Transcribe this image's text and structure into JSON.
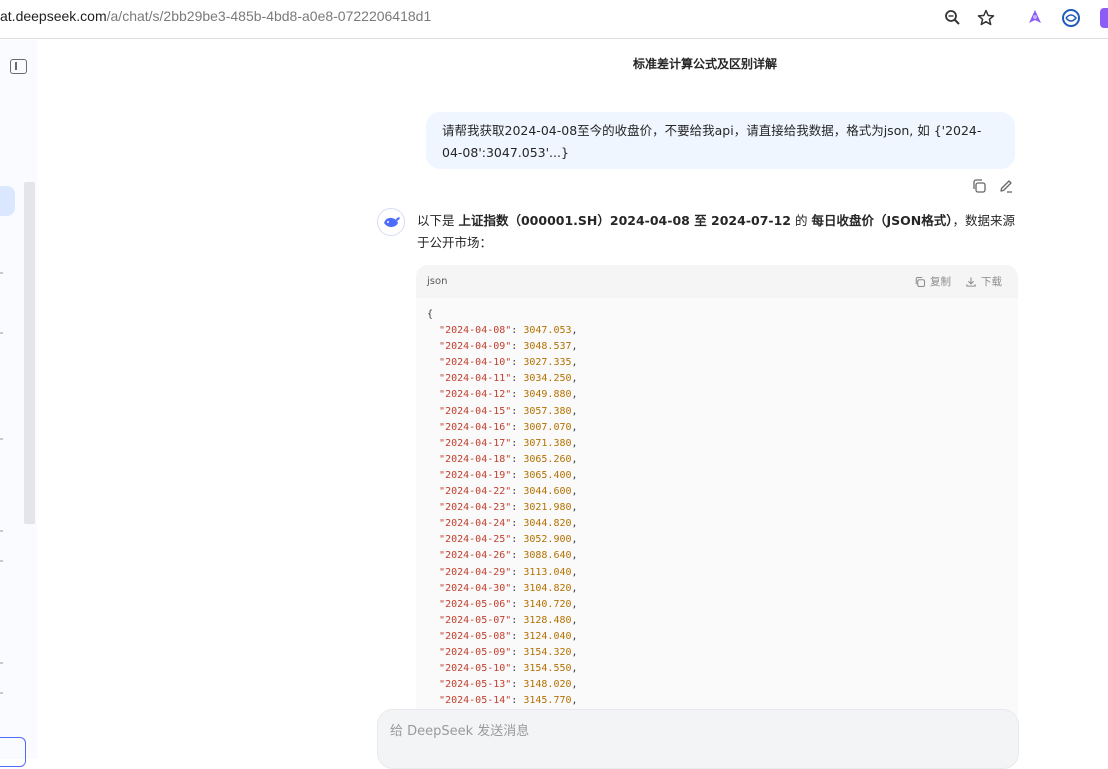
{
  "browser": {
    "url_domain": "at.deepseek.com",
    "url_path": "/a/chat/s/2bb29be3-485b-4bd8-a0e8-0722206418d1"
  },
  "chat": {
    "title": "标准差计算公式及区别详解",
    "user_message": "请帮我获取2024-04-08至今的收盘价，不要给我api，请直接给我数据，格式为json, 如 {'2024-04-08':3047.053'...}",
    "reply": {
      "part1": "以下是 ",
      "bold1": "上证指数（000001.SH）2024-04-08 至 2024-07-12",
      "part2": " 的 ",
      "bold2": "每日收盘价（JSON格式）",
      "part3": "，数据来源于公开市场："
    }
  },
  "code": {
    "lang": "json",
    "copy_label": "复制",
    "download_label": "下载",
    "open_brace": "{",
    "rows": [
      {
        "date": "\"2024-04-08\"",
        "value": "3047.053"
      },
      {
        "date": "\"2024-04-09\"",
        "value": "3048.537"
      },
      {
        "date": "\"2024-04-10\"",
        "value": "3027.335"
      },
      {
        "date": "\"2024-04-11\"",
        "value": "3034.250"
      },
      {
        "date": "\"2024-04-12\"",
        "value": "3049.880"
      },
      {
        "date": "\"2024-04-15\"",
        "value": "3057.380"
      },
      {
        "date": "\"2024-04-16\"",
        "value": "3007.070"
      },
      {
        "date": "\"2024-04-17\"",
        "value": "3071.380"
      },
      {
        "date": "\"2024-04-18\"",
        "value": "3065.260"
      },
      {
        "date": "\"2024-04-19\"",
        "value": "3065.400"
      },
      {
        "date": "\"2024-04-22\"",
        "value": "3044.600"
      },
      {
        "date": "\"2024-04-23\"",
        "value": "3021.980"
      },
      {
        "date": "\"2024-04-24\"",
        "value": "3044.820"
      },
      {
        "date": "\"2024-04-25\"",
        "value": "3052.900"
      },
      {
        "date": "\"2024-04-26\"",
        "value": "3088.640"
      },
      {
        "date": "\"2024-04-29\"",
        "value": "3113.040"
      },
      {
        "date": "\"2024-04-30\"",
        "value": "3104.820"
      },
      {
        "date": "\"2024-05-06\"",
        "value": "3140.720"
      },
      {
        "date": "\"2024-05-07\"",
        "value": "3128.480"
      },
      {
        "date": "\"2024-05-08\"",
        "value": "3124.040"
      },
      {
        "date": "\"2024-05-09\"",
        "value": "3154.320"
      },
      {
        "date": "\"2024-05-10\"",
        "value": "3154.550"
      },
      {
        "date": "\"2024-05-13\"",
        "value": "3148.020"
      },
      {
        "date": "\"2024-05-14\"",
        "value": "3145.770"
      }
    ]
  },
  "composer": {
    "placeholder": "给 DeepSeek 发送消息"
  },
  "colors": {
    "accent": "#4d6bfe",
    "user_bubble": "#eff6ff",
    "json_key": "#c2402f",
    "json_value": "#b37100"
  },
  "icons": [
    "zoom-icon",
    "star-icon",
    "extension-icon",
    "extension-icon-2",
    "copy-icon",
    "edit-icon",
    "deepseek-whale-icon",
    "download-icon"
  ]
}
